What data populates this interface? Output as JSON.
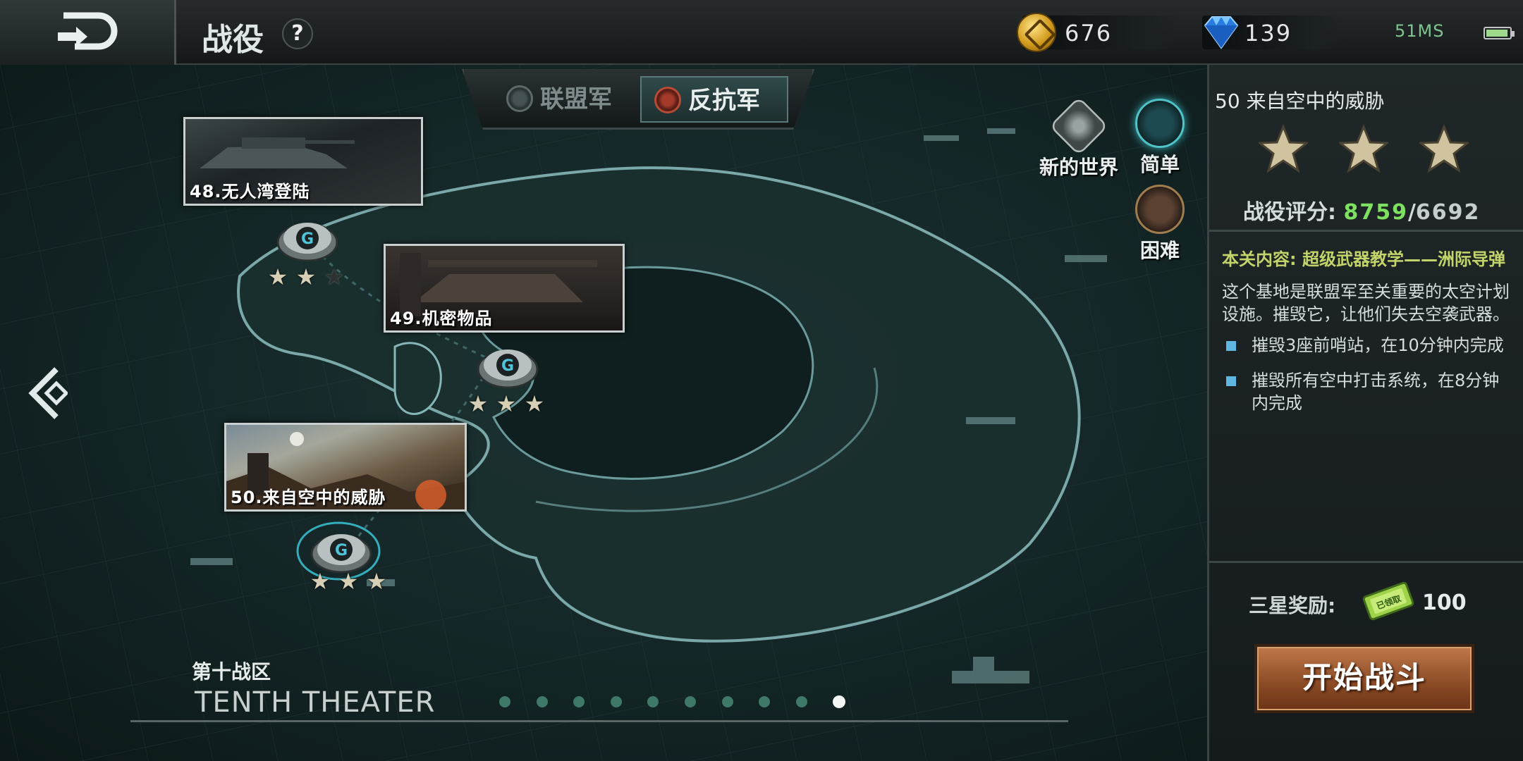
{
  "header": {
    "title": "战役",
    "help_label": "?",
    "gold": "676",
    "gems": "139",
    "network_status": "51MS"
  },
  "tabs": [
    {
      "label": "联盟军",
      "active": false
    },
    {
      "label": "反抗军",
      "active": true
    }
  ],
  "levels": [
    {
      "caption": "48.无人湾登陆",
      "stars": 2,
      "max_stars": 3
    },
    {
      "caption": "49.机密物品",
      "stars": 3,
      "max_stars": 3
    },
    {
      "caption": "50.来自空中的威胁",
      "stars": 3,
      "max_stars": 3,
      "selected": true
    }
  ],
  "difficulty": {
    "new_world": "新的世界",
    "easy": "简单",
    "hard": "困难",
    "selected": "easy"
  },
  "theater": {
    "name_cn": "第十战区",
    "name_en": "TENTH THEATER",
    "page_count": 10,
    "current_page": 10
  },
  "panel": {
    "mission_title": "50 来自空中的威胁",
    "stars_earned": 3,
    "score_label": "战役评分:",
    "score_value": "8759",
    "score_separator": "/",
    "score_target": "6692",
    "content_line": "本关内容: 超级武器教学——洲际导弹",
    "description": "这个基地是联盟军至关重要的太空计划设施。摧毁它，让他们失去空袭武器。",
    "objectives": [
      "摧毁3座前哨站，在10分钟内完成",
      "摧毁所有空中打击系统，在8分钟内完成"
    ],
    "reward_label": "三星奖励:",
    "reward_badge_text": "已领取",
    "reward_value": "100",
    "start_button": "开始战斗"
  },
  "colors": {
    "accent_green": "#7ee060",
    "content_yellow": "#c2d46a",
    "start_button": "#8a4a24",
    "active_dot": "#f4f6f6",
    "inactive_dot": "#3e7868"
  }
}
